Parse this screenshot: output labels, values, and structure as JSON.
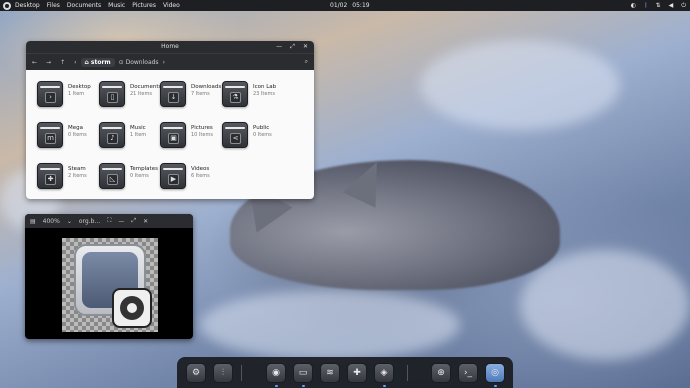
{
  "topbar": {
    "menu": [
      "Desktop",
      "Files",
      "Documents",
      "Music",
      "Pictures",
      "Video"
    ],
    "date": "01/02",
    "time": "05:19"
  },
  "file_manager": {
    "title": "Home",
    "breadcrumb_home": "storm",
    "breadcrumb_next": "Downloads",
    "items": [
      {
        "name": "Desktop",
        "count": "1 Item",
        "icon": "terminal-glyph"
      },
      {
        "name": "Documents",
        "count": "21 Items",
        "icon": "document-glyph"
      },
      {
        "name": "Downloads",
        "count": "7 Items",
        "icon": "download-glyph"
      },
      {
        "name": "Icon Lab",
        "count": "23 Items",
        "icon": "flask-glyph"
      },
      {
        "name": "Mega",
        "count": "0 Items",
        "icon": "cloud-glyph"
      },
      {
        "name": "Music",
        "count": "1 Item",
        "icon": "music-glyph"
      },
      {
        "name": "Pictures",
        "count": "10 Items",
        "icon": "image-glyph"
      },
      {
        "name": "Public",
        "count": "0 Items",
        "icon": "share-glyph"
      },
      {
        "name": "Steam",
        "count": "2 Items",
        "icon": "gamepad-glyph"
      },
      {
        "name": "Templates",
        "count": "0 Items",
        "icon": "template-glyph"
      },
      {
        "name": "Videos",
        "count": "6 Items",
        "icon": "video-glyph"
      }
    ]
  },
  "image_viewer": {
    "zoom": "400%",
    "filename": "org.b..."
  },
  "dock": {
    "apps": [
      "settings-app",
      "mixer-app",
      "chrome-app",
      "files-app",
      "podcast-app",
      "game-app",
      "stack-app",
      "installer-app",
      "terminal-app",
      "eye-app"
    ]
  },
  "colors": {
    "accent": "#6aa0ff",
    "panel": "#1e1f22"
  }
}
